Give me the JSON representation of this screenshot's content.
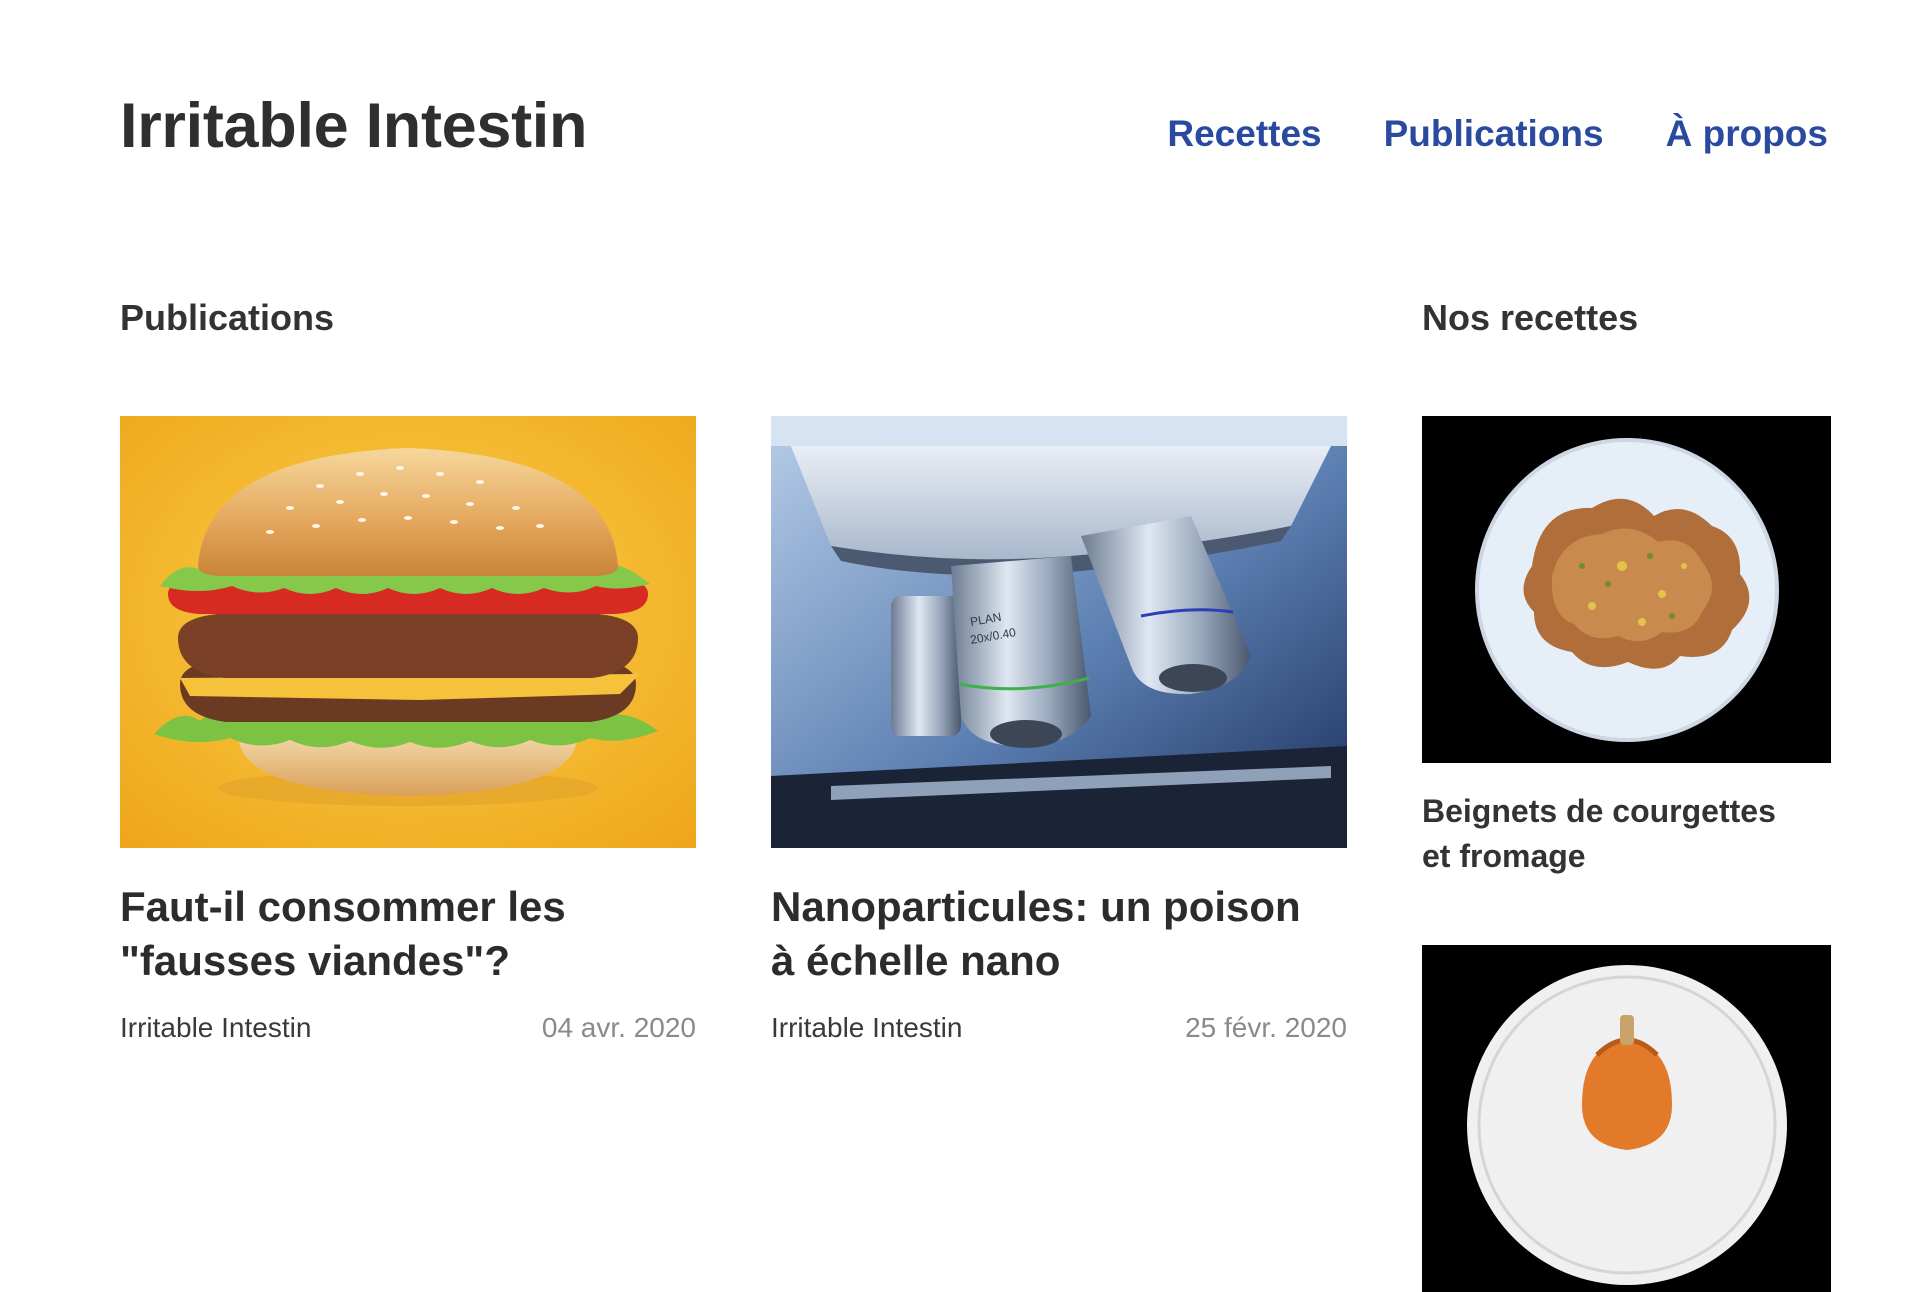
{
  "site": {
    "title": "Irritable Intestin"
  },
  "nav": {
    "items": [
      {
        "label": "Recettes"
      },
      {
        "label": "Publications"
      },
      {
        "label": "À propos"
      }
    ]
  },
  "publications": {
    "heading": "Publications",
    "posts": [
      {
        "title_line1": "Faut-il consommer les",
        "title_line2": "\"fausses viandes\"?",
        "author": "Irritable Intestin",
        "date": "04 avr. 2020",
        "image": "burger-photo"
      },
      {
        "title_line1": "Nanoparticules: un poison",
        "title_line2": "à échelle nano",
        "author": "Irritable Intestin",
        "date": "25 févr. 2020",
        "image": "microscope-photo"
      }
    ]
  },
  "recipes": {
    "heading": "Nos recettes",
    "items": [
      {
        "title_line1": "Beignets de courgettes",
        "title_line2": "et fromage",
        "image": "zucchini-fritters-photo"
      },
      {
        "image": "pumpkin-dish-photo"
      }
    ]
  },
  "colors": {
    "nav_link": "#2a4aa0",
    "heading_text": "#2f2f2f",
    "date_text": "#8a8a8a",
    "burger_bg": "#f4b62c",
    "recipe_bg": "#000000"
  }
}
